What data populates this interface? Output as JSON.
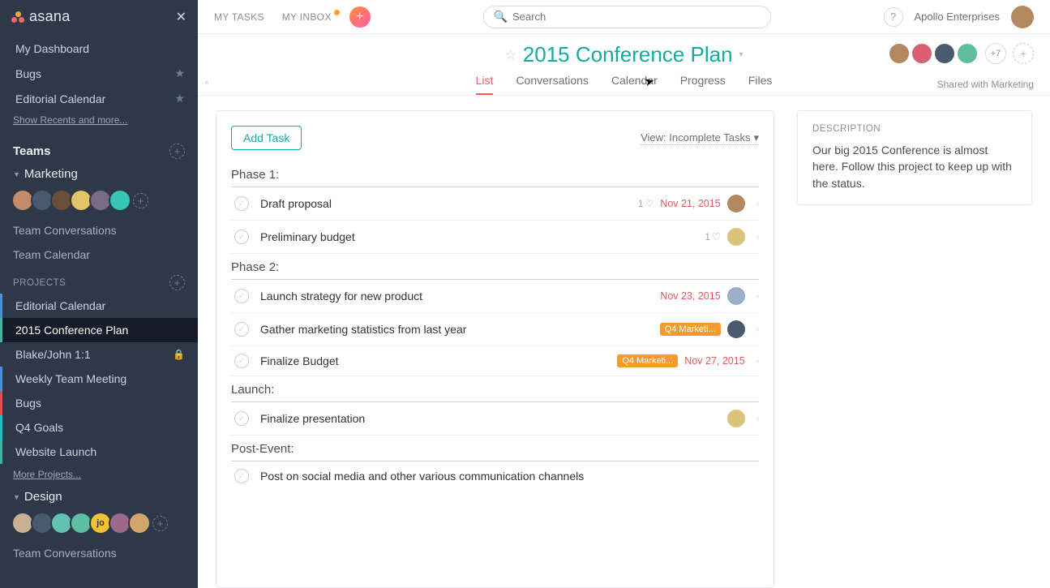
{
  "brand": "asana",
  "sidebar": {
    "dashboard": "My Dashboard",
    "favorites": [
      {
        "label": "Bugs"
      },
      {
        "label": "Editorial Calendar"
      }
    ],
    "recents_link": "Show Recents and more...",
    "teams_heading": "Teams",
    "team1": {
      "name": "Marketing",
      "conversations": "Team Conversations",
      "calendar": "Team Calendar",
      "projects_heading": "PROJECTS",
      "projects": [
        {
          "label": "Editorial Calendar",
          "accent": "blue"
        },
        {
          "label": "2015 Conference Plan",
          "accent": "green",
          "active": true
        },
        {
          "label": "Blake/John 1:1",
          "lock": true
        },
        {
          "label": "Weekly Team Meeting",
          "accent": "blue"
        },
        {
          "label": "Bugs",
          "accent": "red"
        },
        {
          "label": "Q4 Goals",
          "accent": "cyan"
        },
        {
          "label": "Website Launch",
          "accent": "green"
        }
      ],
      "more_projects": "More Projects..."
    },
    "team2": {
      "name": "Design",
      "avatar5_text": "jo",
      "conversations": "Team Conversations"
    }
  },
  "topbar": {
    "my_tasks": "MY TASKS",
    "my_inbox": "MY INBOX",
    "search_placeholder": "Search",
    "org": "Apollo Enterprises"
  },
  "project": {
    "title": "2015 Conference Plan",
    "tabs": {
      "list": "List",
      "conversations": "Conversations",
      "calendar": "Calendar",
      "progress": "Progress",
      "files": "Files"
    },
    "people_more": "+7",
    "shared_label": "Shared with Marketing"
  },
  "pane": {
    "add_task": "Add Task",
    "view_label": "View: Incomplete Tasks",
    "sections": {
      "s1": "Phase 1:",
      "s2": "Phase 2:",
      "s3": "Launch:",
      "s4": "Post-Event:"
    },
    "tasks": {
      "p1t1": {
        "name": "Draft proposal",
        "likes": "1",
        "due": "Nov 21, 2015"
      },
      "p1t2": {
        "name": "Preliminary budget",
        "likes": "1"
      },
      "p2t1": {
        "name": "Launch strategy for new product",
        "due": "Nov 23, 2015"
      },
      "p2t2": {
        "name": "Gather marketing statistics from last year",
        "tag": "Q4 Marketi..."
      },
      "p2t3": {
        "name": "Finalize Budget",
        "tag": "Q4 Marketi...",
        "due": "Nov 27, 2015"
      },
      "p3t1": {
        "name": "Finalize presentation"
      },
      "p4t1": {
        "name": "Post on social media and other various communication channels"
      }
    }
  },
  "description": {
    "heading": "DESCRIPTION",
    "body": "Our big 2015 Conference is almost here. Follow this project to keep up with the status."
  }
}
